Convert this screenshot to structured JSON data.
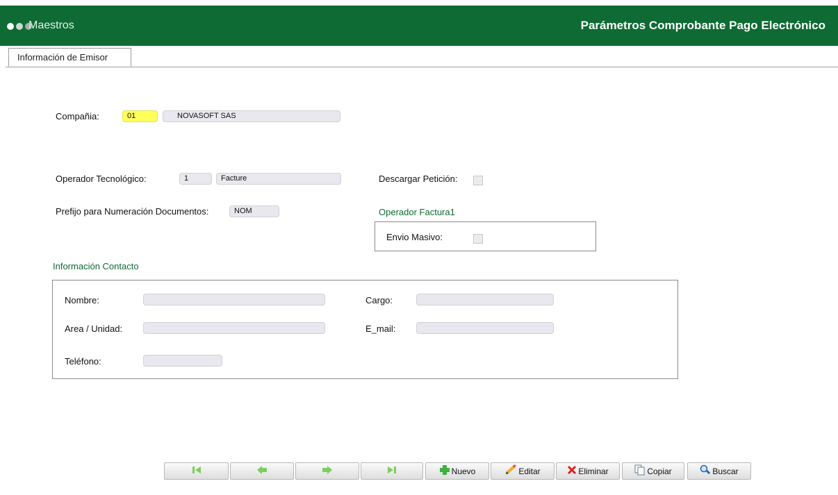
{
  "header": {
    "app_title": "Maestros",
    "page_title": "Parámetros Comprobante Pago Electrónico",
    "dots": [
      "#ffffff",
      "#cfd8d2",
      "#9fb3a7"
    ]
  },
  "tabs": [
    {
      "label": "Información de Emisor",
      "active": true
    }
  ],
  "form": {
    "company_label": "Compañia:",
    "company_code": "01",
    "company_name": "NOVASOFT SAS",
    "operator_label": "Operador Tecnológico:",
    "operator_code": "1",
    "operator_name": "Facture",
    "download_label": "Descargar Petición:",
    "prefix_label": "Prefijo para Numeración Documentos:",
    "prefix_value": "NOM",
    "operator_section_title": "Operador Factura1",
    "bulk_send_label": "Envio Masivo:"
  },
  "contact": {
    "section_title": "Información Contacto",
    "name_label": "Nombre:",
    "name_value": "",
    "role_label": "Cargo:",
    "role_value": "",
    "area_label": "Area / Unidad:",
    "area_value": "",
    "email_label": "E_mail:",
    "email_value": "",
    "phone_label": "Teléfono:",
    "phone_value": ""
  },
  "toolbar": {
    "first_icon": "first-record-icon",
    "prev_icon": "previous-record-icon",
    "next_icon": "next-record-icon",
    "last_icon": "last-record-icon",
    "new_label": "Nuevo",
    "edit_label": "Editar",
    "delete_label": "Eliminar",
    "copy_label": "Copiar",
    "search_label": "Buscar"
  },
  "colors": {
    "brand_green": "#0e6b33",
    "highlight_yellow": "#ffff5a",
    "nav_arrow_green": "#7ccf5a"
  }
}
